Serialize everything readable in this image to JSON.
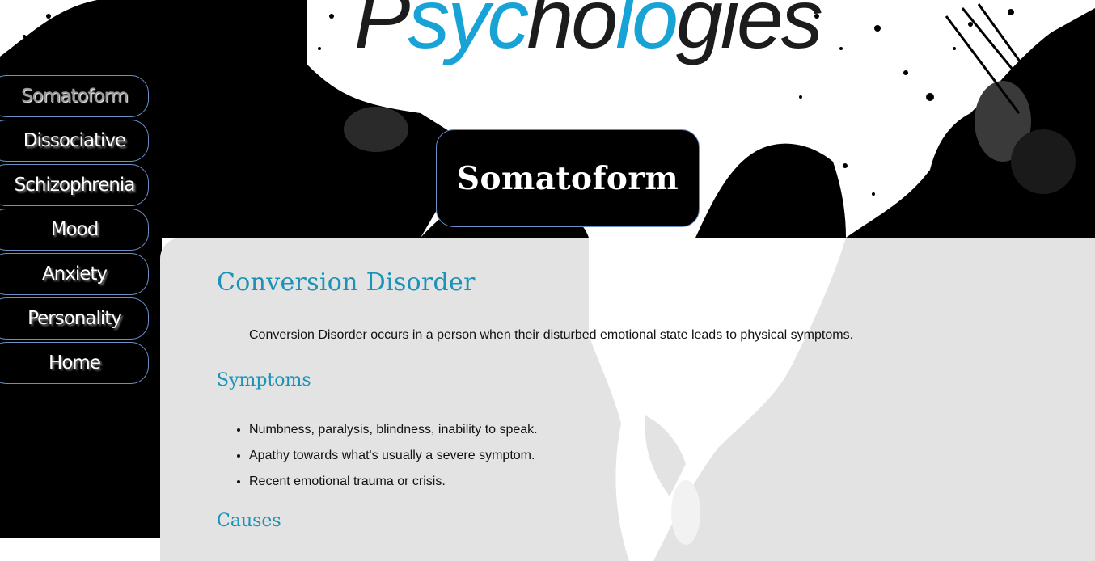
{
  "logo": {
    "text_before": "P",
    "text_accent1": "syc",
    "text_mid": "ho",
    "text_accent2": "lo",
    "text_after": "gies"
  },
  "nav": {
    "items": [
      {
        "label": "Somatoform"
      },
      {
        "label": "Dissociative"
      },
      {
        "label": "Schizophrenia"
      },
      {
        "label": "Mood"
      },
      {
        "label": "Anxiety"
      },
      {
        "label": "Personality"
      },
      {
        "label": "Home"
      }
    ],
    "active_index": 0
  },
  "page_title": "Somatoform",
  "content": {
    "heading": "Conversion Disorder",
    "intro": "Conversion Disorder occurs in a person when their disturbed emotional state leads to physical symptoms.",
    "symptoms_heading": "Symptoms",
    "symptoms": [
      "Numbness, paralysis, blindness, inability to speak.",
      "Apathy towards what's usually a severe symptom.",
      "Recent emotional trauma or crisis."
    ],
    "causes_heading": "Causes"
  },
  "colors": {
    "accent": "#1a93b8",
    "logo_accent": "#17a3d5",
    "nav_border": "#6c8fc7",
    "content_bg": "#e3e3e3"
  }
}
